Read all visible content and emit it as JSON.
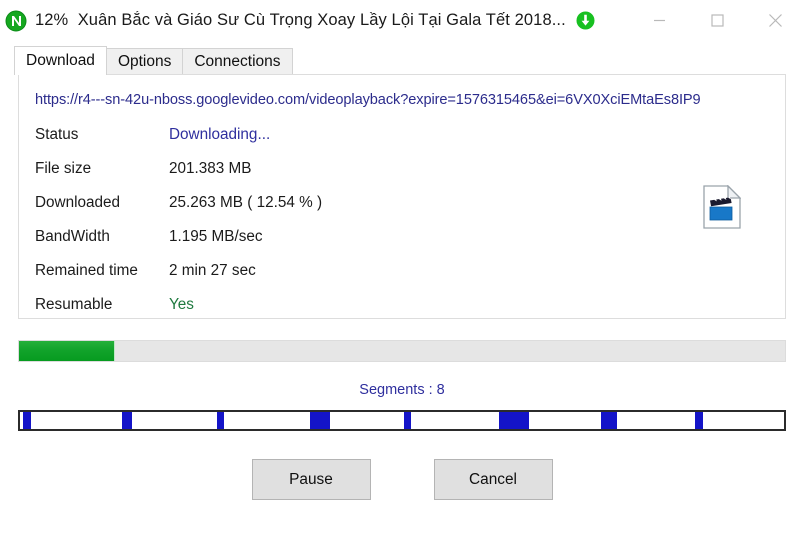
{
  "window": {
    "progress_prefix": "12%",
    "title": "Xuân Bắc và Giáo Sư Cù Trọng Xoay Lầy Lội Tại Gala Tết 2018...",
    "app_icon": "idm-n-green-icon",
    "download_badge_icon": "download-arrow-icon",
    "controls": {
      "minimize": "minimize-icon",
      "maximize": "maximize-icon",
      "close": "close-icon"
    }
  },
  "tabs": [
    {
      "label": "Download",
      "active": true
    },
    {
      "label": "Options",
      "active": false
    },
    {
      "label": "Connections",
      "active": false
    }
  ],
  "details": {
    "url": "https://r4---sn-42u-nboss.googlevideo.com/videoplayback?expire=1576315465&ei=6VX0XciEMtaEs8IP9",
    "file_icon": "video-file-icon",
    "rows": [
      {
        "label": "Status",
        "value": "Downloading...",
        "style": "status"
      },
      {
        "label": "File size",
        "value": "201.383 MB",
        "style": ""
      },
      {
        "label": "Downloaded",
        "value": "25.263 MB ( 12.54 % )",
        "style": ""
      },
      {
        "label": "BandWidth",
        "value": "1.195 MB/sec",
        "style": ""
      },
      {
        "label": "Remained time",
        "value": "2 min  27 sec",
        "style": ""
      },
      {
        "label": "Resumable",
        "value": "Yes",
        "style": "resumable"
      }
    ]
  },
  "progress": {
    "percent": 12.54,
    "fill_color": "#12a32b",
    "track_color": "#e6e6e6"
  },
  "segments": {
    "label": "Segments : 8",
    "count": 8,
    "block_color": "#1414c8",
    "blocks": [
      {
        "left_pct": 0.4,
        "width_pct": 1.1
      },
      {
        "left_pct": 13.3,
        "width_pct": 1.4
      },
      {
        "left_pct": 25.8,
        "width_pct": 0.9
      },
      {
        "left_pct": 38.0,
        "width_pct": 2.6
      },
      {
        "left_pct": 50.3,
        "width_pct": 0.9
      },
      {
        "left_pct": 62.7,
        "width_pct": 3.9
      },
      {
        "left_pct": 76.0,
        "width_pct": 2.2
      },
      {
        "left_pct": 88.4,
        "width_pct": 1.0
      }
    ]
  },
  "actions": {
    "pause_label": "Pause",
    "cancel_label": "Cancel"
  }
}
